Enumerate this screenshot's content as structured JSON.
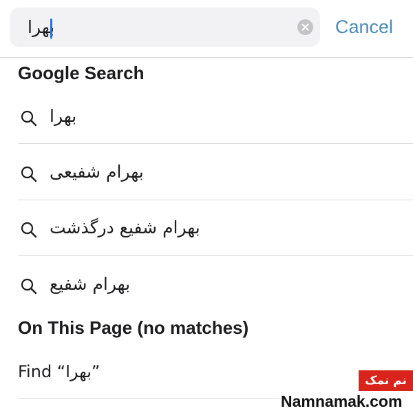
{
  "search": {
    "value": "بهرا",
    "cancel_label": "Cancel"
  },
  "google_search": {
    "header": "Google Search",
    "suggestions": [
      {
        "label": "بهرا"
      },
      {
        "label": "بهرام شفیعی"
      },
      {
        "label": "بهرام شفیع درگذشت"
      },
      {
        "label": "بهرام شفیع"
      }
    ]
  },
  "on_this_page": {
    "header": "On This Page (no matches)",
    "find_label": "Find “بهرا”"
  },
  "watermark": {
    "badge": "نم نمک",
    "site": "Namnamak.com"
  },
  "icons": {
    "suggestion": "search-icon",
    "clear": "clear-circle-icon"
  },
  "colors": {
    "accent": "#4b8ab6",
    "caret": "#2b6fd8",
    "search_field_bg": "#f2f2f4",
    "watermark_badge": "#d9241c"
  }
}
